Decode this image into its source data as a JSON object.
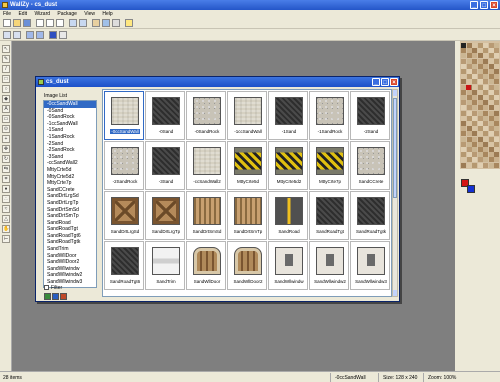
{
  "app": {
    "title": "WallZy - cs_dust",
    "min_icon": "minimize-icon",
    "max_icon": "maximize-icon",
    "close_icon": "close-icon"
  },
  "menu": [
    "File",
    "Edit",
    "Wizard",
    "Package",
    "View",
    "Help"
  ],
  "dialog": {
    "title": "cs_dust",
    "image_list_label": "Image List",
    "filter_label": "Filter",
    "list_items": [
      "-0ccSandWall",
      "-0Sand",
      "-0SandRock",
      "-1ccSandWall",
      "-1Sand",
      "-1SandRock",
      "-2Sand",
      "-2SandRock",
      "-3Sand",
      "-ccSandWall2",
      "MttyCrte5d",
      "MttyCrte5d2",
      "MttyCrte7p",
      "SandCCrete",
      "SandDrtLrgSd",
      "SandDrtLrgTp",
      "SandDrtSmSd",
      "SandDrtSmTp",
      "SandRoad",
      "SandRoadTgt",
      "SandRoadTgt6",
      "SandRoadTgtk",
      "SandTrim",
      "SandWllDoor",
      "SandWllDoor2",
      "SandWllwindw",
      "SandWllwindw2",
      "SandWllwindw3"
    ],
    "grid": [
      {
        "caption": "-0ccSandWall",
        "tex": "sandwall"
      },
      {
        "caption": "-0Sand",
        "tex": "dark"
      },
      {
        "caption": "-0SandRock",
        "tex": "rock"
      },
      {
        "caption": "-1ccSandWall",
        "tex": "sandwall"
      },
      {
        "caption": "-1Sand",
        "tex": "dark"
      },
      {
        "caption": "-1SandRock",
        "tex": "rock"
      },
      {
        "caption": "-2Sand",
        "tex": "dark"
      },
      {
        "caption": "-2SandRock",
        "tex": "rock"
      },
      {
        "caption": "-3Sand",
        "tex": "dark"
      },
      {
        "caption": "-ccSandWall2",
        "tex": "sandwall"
      },
      {
        "caption": "MttyCrte5d",
        "tex": "hazard"
      },
      {
        "caption": "MttyCrte5d2",
        "tex": "hazard"
      },
      {
        "caption": "MttyCrte7p",
        "tex": "hazard"
      },
      {
        "caption": "SandCCrete",
        "tex": "rock"
      },
      {
        "caption": "SandDrtLrgSd",
        "tex": "crate"
      },
      {
        "caption": "SandDrtLrgTp",
        "tex": "crate"
      },
      {
        "caption": "SandDrtSmSd",
        "tex": "wood"
      },
      {
        "caption": "SandDrtSmTp",
        "tex": "wood"
      },
      {
        "caption": "SandRoad",
        "tex": "road"
      },
      {
        "caption": "SandRoadTgt",
        "tex": "dark"
      },
      {
        "caption": "SandRoadTgtk",
        "tex": "dark"
      },
      {
        "caption": "SandRoadTgt6",
        "tex": "dark"
      },
      {
        "caption": "SandTrim",
        "tex": "trim"
      },
      {
        "caption": "SandWllDoor",
        "tex": "door"
      },
      {
        "caption": "SandWllDoor2",
        "tex": "door"
      },
      {
        "caption": "SandWllwindw",
        "tex": "window"
      },
      {
        "caption": "SandWllwindw2",
        "tex": "window"
      },
      {
        "caption": "SandWllwindw3",
        "tex": "window"
      }
    ]
  },
  "status": {
    "items": "28 items",
    "selected": "-0ccSandWall",
    "size": "Size: 128 x 240",
    "zoom": "Zoom: 100%"
  },
  "colors": {
    "accent": "#316ac5",
    "titlebar": "#2456c8",
    "workspace": "#7f7f7f"
  }
}
